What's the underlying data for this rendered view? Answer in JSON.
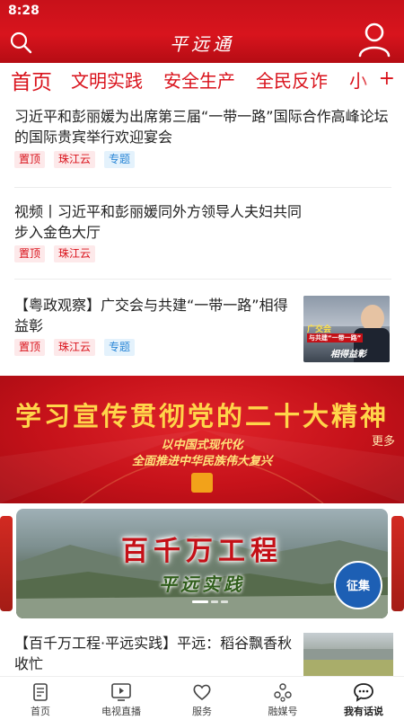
{
  "status": {
    "time": "8:28"
  },
  "header": {
    "title": "平远通"
  },
  "tabs": [
    {
      "label": "首页"
    },
    {
      "label": "文明实践"
    },
    {
      "label": "安全生产"
    },
    {
      "label": "全民反诈"
    },
    {
      "label": "小"
    }
  ],
  "tab_add": "+",
  "news": [
    {
      "title": "习近平和彭丽媛为出席第三届“一带一路”国际合作高峰论坛的国际贵宾举行欢迎宴会",
      "tags": [
        "置顶",
        "珠江云",
        "专题"
      ]
    },
    {
      "title": "视频丨习近平和彭丽媛同外方领导人夫妇共同步入金色大厅",
      "tags": [
        "置顶",
        "珠江云"
      ]
    },
    {
      "title": "【粤政观察】广交会与共建“一带一路”相得益彰",
      "tags": [
        "置顶",
        "珠江云",
        "专题"
      ],
      "thumb_text": [
        "广交会",
        "与共建“一带一路”",
        "相得益彰"
      ]
    },
    {
      "title": "【百千万工程·平远实践】平远：稻谷飘香秋收忙"
    }
  ],
  "banner": {
    "title": "学习宣传贯彻党的二十大精神",
    "line1": "以中国式现代化",
    "line2": "全面推进中华民族伟大复兴",
    "more": "更多"
  },
  "carousel": {
    "title": "百千万工程",
    "subtitle": "平远实践",
    "badge": "征集",
    "active_index": 0,
    "count": 3
  },
  "tabbar": [
    {
      "label": "首页",
      "icon": "home-icon"
    },
    {
      "label": "电视直播",
      "icon": "tv-icon"
    },
    {
      "label": "服务",
      "icon": "heart-icon"
    },
    {
      "label": "融媒号",
      "icon": "media-icon"
    },
    {
      "label": "我有话说",
      "icon": "chat-icon"
    }
  ],
  "colors": {
    "brand_red": "#d9121b",
    "tag_blue": "#2a86d6"
  }
}
